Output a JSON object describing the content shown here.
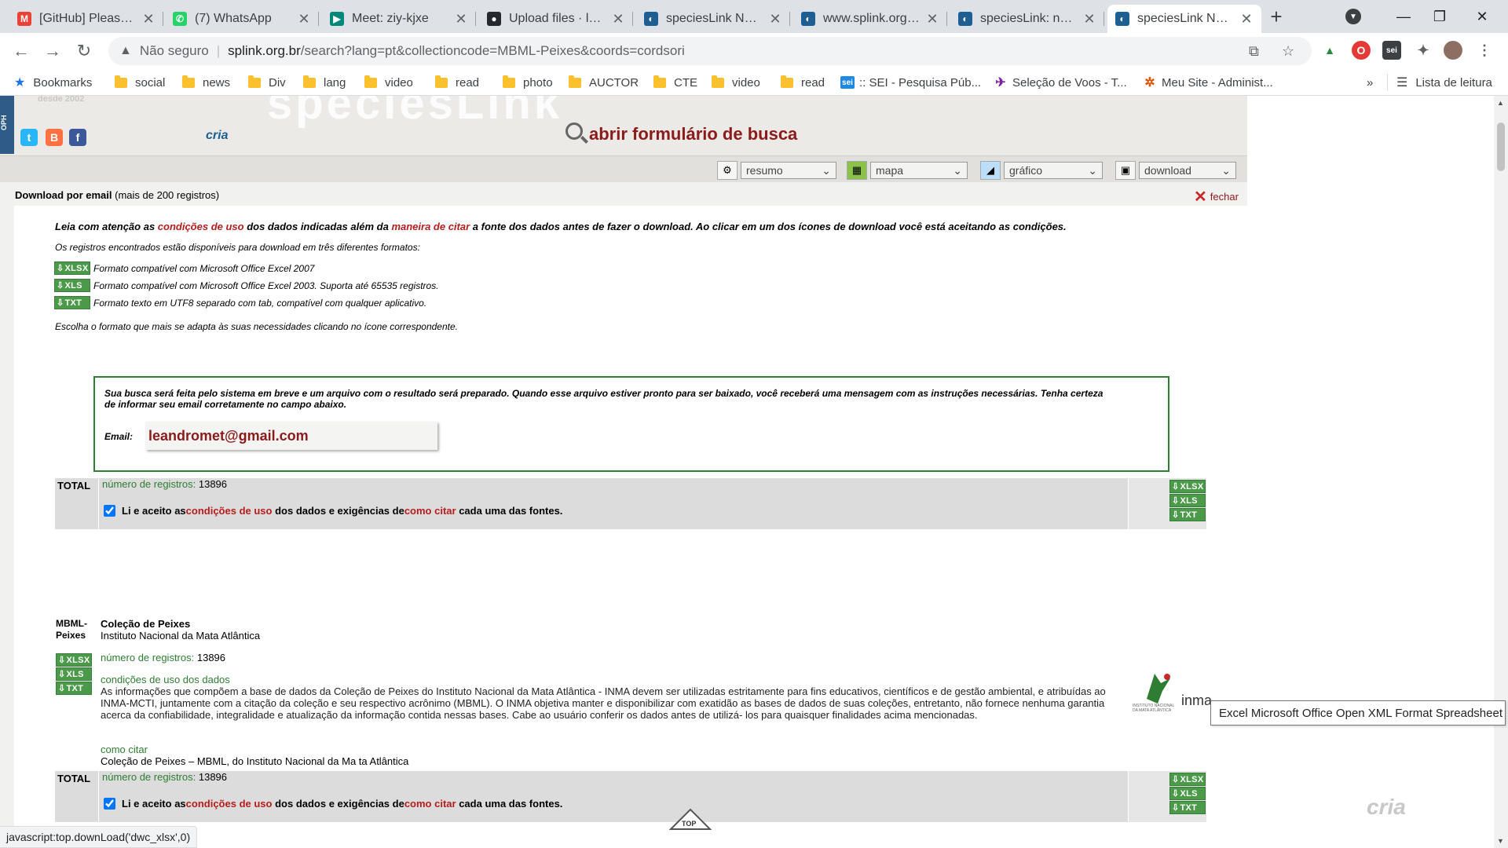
{
  "browser": {
    "tabs": [
      {
        "title": "[GitHub] Please ve",
        "icon": "gmail-icon",
        "color": "#ea4335",
        "glyph": "M"
      },
      {
        "title": "(7) WhatsApp",
        "icon": "whatsapp-icon",
        "color": "#25d366",
        "glyph": "✆"
      },
      {
        "title": "Meet: ziy-kjxe",
        "icon": "meet-icon",
        "color": "#00897b",
        "glyph": "▶"
      },
      {
        "title": "Upload files · lean",
        "icon": "github-icon",
        "color": "#24292e",
        "glyph": "●"
      },
      {
        "title": "speciesLink Netwo",
        "icon": "specieslink-icon",
        "color": "#1d5f93",
        "glyph": "◐"
      },
      {
        "title": "www.splink.org.br",
        "icon": "specieslink-icon",
        "color": "#1d5f93",
        "glyph": "◐"
      },
      {
        "title": "speciesLink: netwo",
        "icon": "specieslink-icon",
        "color": "#1d5f93",
        "glyph": "◐"
      },
      {
        "title": "speciesLink Netwo",
        "icon": "specieslink-icon",
        "color": "#1d5f93",
        "glyph": "◐"
      }
    ],
    "omnibox": {
      "security": "Não seguro",
      "domain": "splink.org.br",
      "path": "/search?lang=pt&collectioncode=MBML-Peixes&coords=cordsori"
    },
    "bookmarks": {
      "label": "Bookmarks",
      "items": [
        "social",
        "news",
        "Div",
        "lang",
        "video",
        "read",
        "photo",
        "AUCTOR",
        "CTE",
        "video",
        "read"
      ],
      "sei": ":: SEI - Pesquisa Púb...",
      "voos": "Seleção de Voos - T...",
      "meusite": "Meu Site - Administ...",
      "more": "»",
      "reading_list": "Lista de leitura"
    },
    "status_url": "javascript:top.downLoad('dwc_xlsx',0)",
    "tooltip": "Excel Microsoft Office Open XML Format Spreadsheet"
  },
  "site": {
    "side_tab": "OPH",
    "since": "desde 2002",
    "faded_logo": "speciesLink",
    "cria": "cria",
    "search_link": "abrir formulário de busca",
    "tools": {
      "resumo": "resumo",
      "mapa": "mapa",
      "grafico": "gráfico",
      "download": "download"
    },
    "download_header": {
      "title": "Download por email",
      "note": "(mais de 200 registros)",
      "close": "fechar"
    },
    "notice": {
      "p1": "Leia com atenção as ",
      "link1": "condições de uso",
      "p2": " dos dados indicadas além da ",
      "link2": "maneira de citar",
      "p3": " a fonte dos dados antes de fazer o download. Ao clicar em um dos ícones de download você está aceitando as condições."
    },
    "formats_intro": "Os registros encontrados estão disponíveis para download em três diferentes formatos:",
    "formats": [
      {
        "label": "XLSX",
        "desc": "Formato compatível com Microsoft Office Excel 2007"
      },
      {
        "label": "XLS",
        "desc": "Formato compatível com Microsoft Office Excel 2003. Suporta até 65535 registros."
      },
      {
        "label": "TXT",
        "desc": "Formato texto em UTF8 separado com tab, compatível com qualquer aplicativo."
      }
    ],
    "choose_text": "Escolha o formato que mais se adapta às suas necessidades clicando no ícone correspondente.",
    "email_box": {
      "message": "Sua busca será feita pelo sistema em breve e um arquivo com o resultado será preparado. Quando esse arquivo estiver pronto para ser baixado, você receberá uma mensagem com as instruções necessárias. Tenha certeza de informar seu email corretamente no campo abaixo.",
      "label": "Email:",
      "value": "leandromet@gmail.com"
    },
    "total": {
      "label": "TOTAL",
      "count_label": "número de registros:",
      "count": "13896",
      "agree_p1": "Li e aceito as ",
      "agree_link1": "condições de uso",
      "agree_p2": " dos dados e exigências de ",
      "agree_link2": "como citar",
      "agree_p3": " cada uma das fontes."
    },
    "collection": {
      "code_line1": "MBML-",
      "code_line2": "Peixes",
      "name": "Coleção de Peixes",
      "institution": "Instituto Nacional da Mata Atlântica",
      "count_label": "número de registros:",
      "count": "13896",
      "terms_label": "condições de uso dos dados",
      "terms_text": "As informações que compõem a base de dados da Coleção de Peixes do Instituto Nacional da Mata Atlântica - INMA devem ser utilizadas estritamente para fins educativos, científicos e de gestão ambiental, e atribuídas ao INMA-MCTI, juntamente com a citação da coleção e seu respectivo acrônimo (MBML). O INMA objetiva manter e disponibilizar com exatidão as bases de dados de suas coleções, entretanto, não fornece nenhuma garantia acerca da confiabilidade, integralidade e atualização da informação contida nessas bases. Cabe ao usuário conferir os dados antes de utilizá- los para quaisquer finalidades acima mencionadas.",
      "cite_label": "como citar",
      "cite_text": "Coleção de Peixes – MBML, do Instituto Nacional da Ma ta Atlântica",
      "logo_text": "inma",
      "logo_small": "INSTITUTO NACIONAL DA MATA ATLÂNTICA"
    },
    "top_label": "TOP",
    "cria_footer": "cria"
  }
}
